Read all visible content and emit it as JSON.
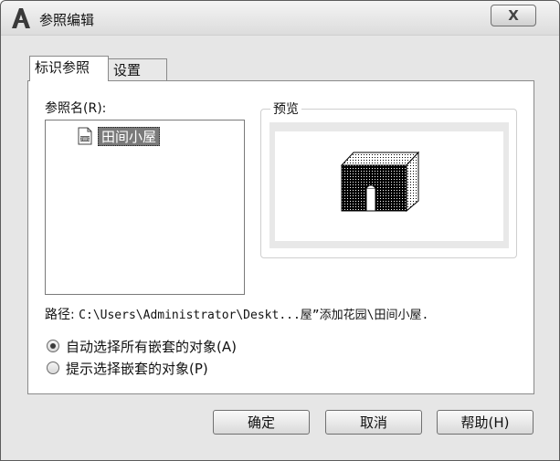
{
  "window": {
    "title": "参照编辑",
    "close_label": "X"
  },
  "tabs": [
    {
      "label": "标识参照",
      "active": true
    },
    {
      "label": "设置",
      "active": false
    }
  ],
  "reference_name": {
    "label": "参照名(R):",
    "items": [
      {
        "icon": "drawing-file-icon",
        "label": "田间小屋",
        "selected": true
      }
    ]
  },
  "preview": {
    "label": "预览",
    "image": "house-block-preview"
  },
  "path": {
    "label": "路径:",
    "value": "C:\\Users\\Administrator\\Deskt...屋”添加花园\\田间小屋."
  },
  "options": [
    {
      "label": "自动选择所有嵌套的对象(A)",
      "checked": true
    },
    {
      "label": "提示选择嵌套的对象(P)",
      "checked": false
    }
  ],
  "buttons": {
    "ok": "确定",
    "cancel": "取消",
    "help": "帮助(H)"
  }
}
